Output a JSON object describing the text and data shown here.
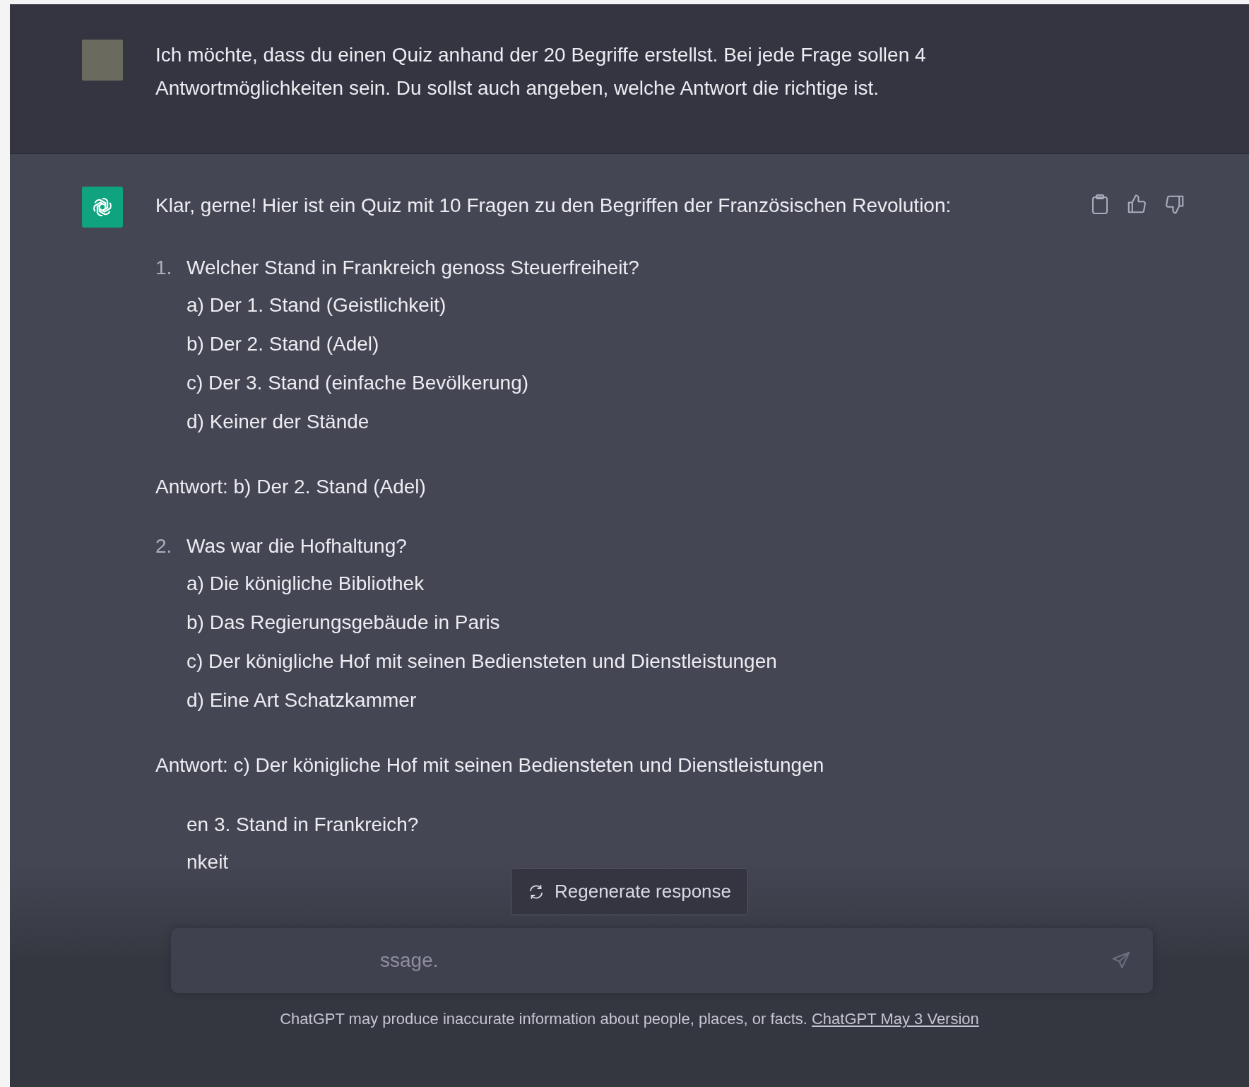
{
  "user_message": {
    "text": "Ich möchte, dass du einen Quiz anhand der 20 Begriffe erstellst. Bei jede Frage sollen 4 Antwortmöglichkeiten sein. Du sollst auch angeben, welche Antwort die richtige ist."
  },
  "assistant_message": {
    "intro": "Klar, gerne! Hier ist ein Quiz mit 10 Fragen zu den Begriffen der Französischen Revolution:",
    "questions": [
      {
        "number": "1.",
        "question": "Welcher Stand in Frankreich genoss Steuerfreiheit?",
        "options": [
          "a) Der 1. Stand (Geistlichkeit)",
          "b) Der 2. Stand (Adel)",
          "c) Der 3. Stand (einfache Bevölkerung)",
          "d) Keiner der Stände"
        ],
        "answer": "Antwort: b) Der 2. Stand (Adel)"
      },
      {
        "number": "2.",
        "question": "Was war die Hofhaltung?",
        "options": [
          "a) Die königliche Bibliothek",
          "b) Das Regierungsgebäude in Paris",
          "c) Der königliche Hof mit seinen Bediensteten und Dienstleistungen",
          "d) Eine Art Schatzkammer"
        ],
        "answer": "Antwort: c) Der königliche Hof mit seinen Bediensteten und Dienstleistungen"
      },
      {
        "question": "en 3. Stand in Frankreich?",
        "options": [
          "nkeit"
        ]
      }
    ]
  },
  "regenerate_button": {
    "label": "Regenerate response"
  },
  "composer": {
    "placeholder": "ssage."
  },
  "footer": {
    "text": "ChatGPT may produce inaccurate information about people, places, or facts.",
    "link": "ChatGPT May 3 Version"
  }
}
